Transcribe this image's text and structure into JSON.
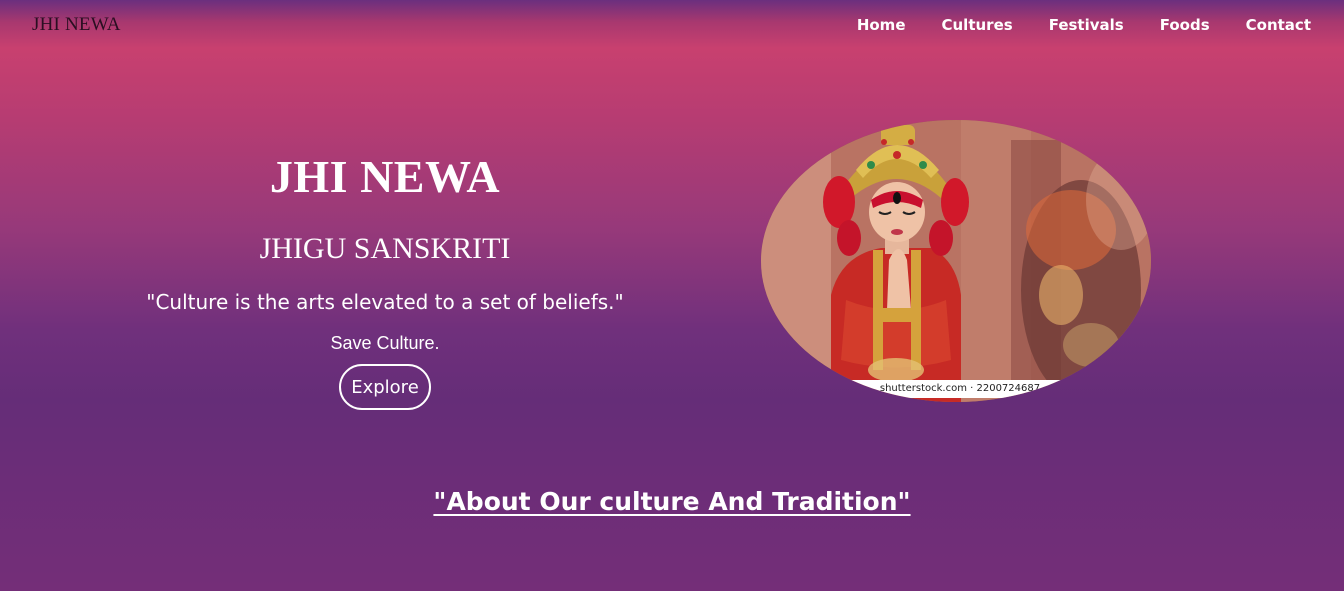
{
  "brand": "JHI NEWA",
  "nav": {
    "items": [
      "Home",
      "Cultures",
      "Festivals",
      "Foods",
      "Contact"
    ]
  },
  "hero": {
    "title": "JHI NEWA",
    "subtitle": "JHIGU SANSKRITI",
    "quote": "\"Culture is the arts elevated to a set of beliefs.\"",
    "tagline": "Save Culture.",
    "button_label": "Explore"
  },
  "image": {
    "watermark": "shutterstock.com · 2200724687"
  },
  "about": {
    "heading": "\"About Our culture And Tradition\""
  }
}
